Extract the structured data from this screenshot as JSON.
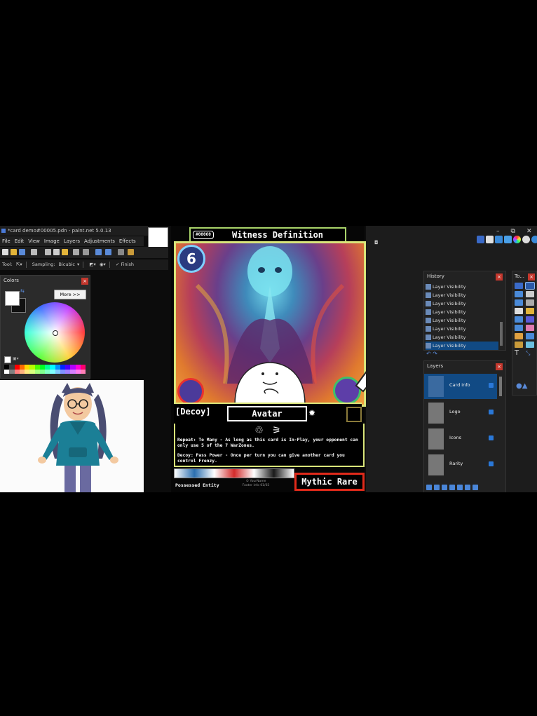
{
  "window": {
    "title": "*card demo#00005.pdn - paint.net 5.0.13",
    "menu": [
      "File",
      "Edit",
      "View",
      "Image",
      "Layers",
      "Adjustments",
      "Effects"
    ]
  },
  "toolbar": {
    "tool_label": "Tool:",
    "sampling_label": "Sampling:",
    "sampling_value": "Bicubic",
    "finish_label": "Finish"
  },
  "colors_panel": {
    "title": "Colors",
    "more_button": "More >>",
    "primary_color": "#ffffff",
    "secondary_color": "#111111"
  },
  "card": {
    "number": "#00060",
    "name": "Witness Definition",
    "cost": "6",
    "subtype": "[Decoy]",
    "type": "Avatar",
    "rule_icons": "♲ ⚞",
    "rules": [
      "Repeat: To Many - As long as this card is In-Play, your opponent can only use 5 of the 7 WarZones.",
      "Decoy: Pass Power - Once per turn you can give another card you control Frenzy."
    ],
    "footer_text": "Possessed Entity",
    "credit": "© YourName",
    "credit_line2": "Footer info 01/03",
    "rarity": "Mythic Rare",
    "accent_color": "#d9e57a",
    "rarity_color": "#e02a1a"
  },
  "history": {
    "title": "History",
    "items": [
      "Layer Visibility",
      "Layer Visibility",
      "Layer Visibility",
      "Layer Visibility",
      "Layer Visibility",
      "Layer Visibility",
      "Layer Visibility",
      "Layer Visibility"
    ]
  },
  "layers": {
    "title": "Layers",
    "items": [
      "Card info",
      "Logo",
      "Icons",
      "Rarity"
    ]
  },
  "tools": {
    "title": "To..."
  }
}
